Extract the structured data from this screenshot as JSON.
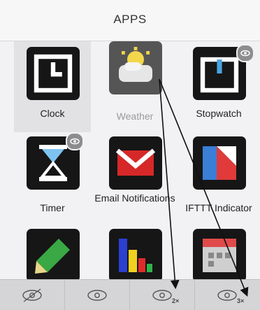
{
  "header": {
    "title": "APPS"
  },
  "apps": [
    {
      "label": "Clock",
      "icon": "clock-icon"
    },
    {
      "label": "Weather",
      "icon": "weather-icon",
      "dim": true
    },
    {
      "label": "Stopwatch",
      "icon": "stopwatch-icon"
    },
    {
      "label": "Timer",
      "icon": "hourglass-icon"
    },
    {
      "label": "Email Notifications",
      "icon": "email-icon"
    },
    {
      "label": "IFTTT Indicator",
      "icon": "ifttt-icon"
    },
    {
      "label": "",
      "icon": "pencil-icon"
    },
    {
      "label": "",
      "icon": "bar-chart-icon"
    },
    {
      "label": "",
      "icon": "calendar-icon"
    }
  ],
  "toolbar": {
    "buttons": [
      {
        "icon": "eye-hidden-icon",
        "sub": ""
      },
      {
        "icon": "eye-icon",
        "sub": ""
      },
      {
        "icon": "eye-2x-icon",
        "sub": "2×"
      },
      {
        "icon": "eye-3x-icon",
        "sub": "3×"
      }
    ]
  },
  "colors": {
    "tile": "#161616",
    "badge": "#8d8d90",
    "toolbar": "#d5d5d8"
  }
}
